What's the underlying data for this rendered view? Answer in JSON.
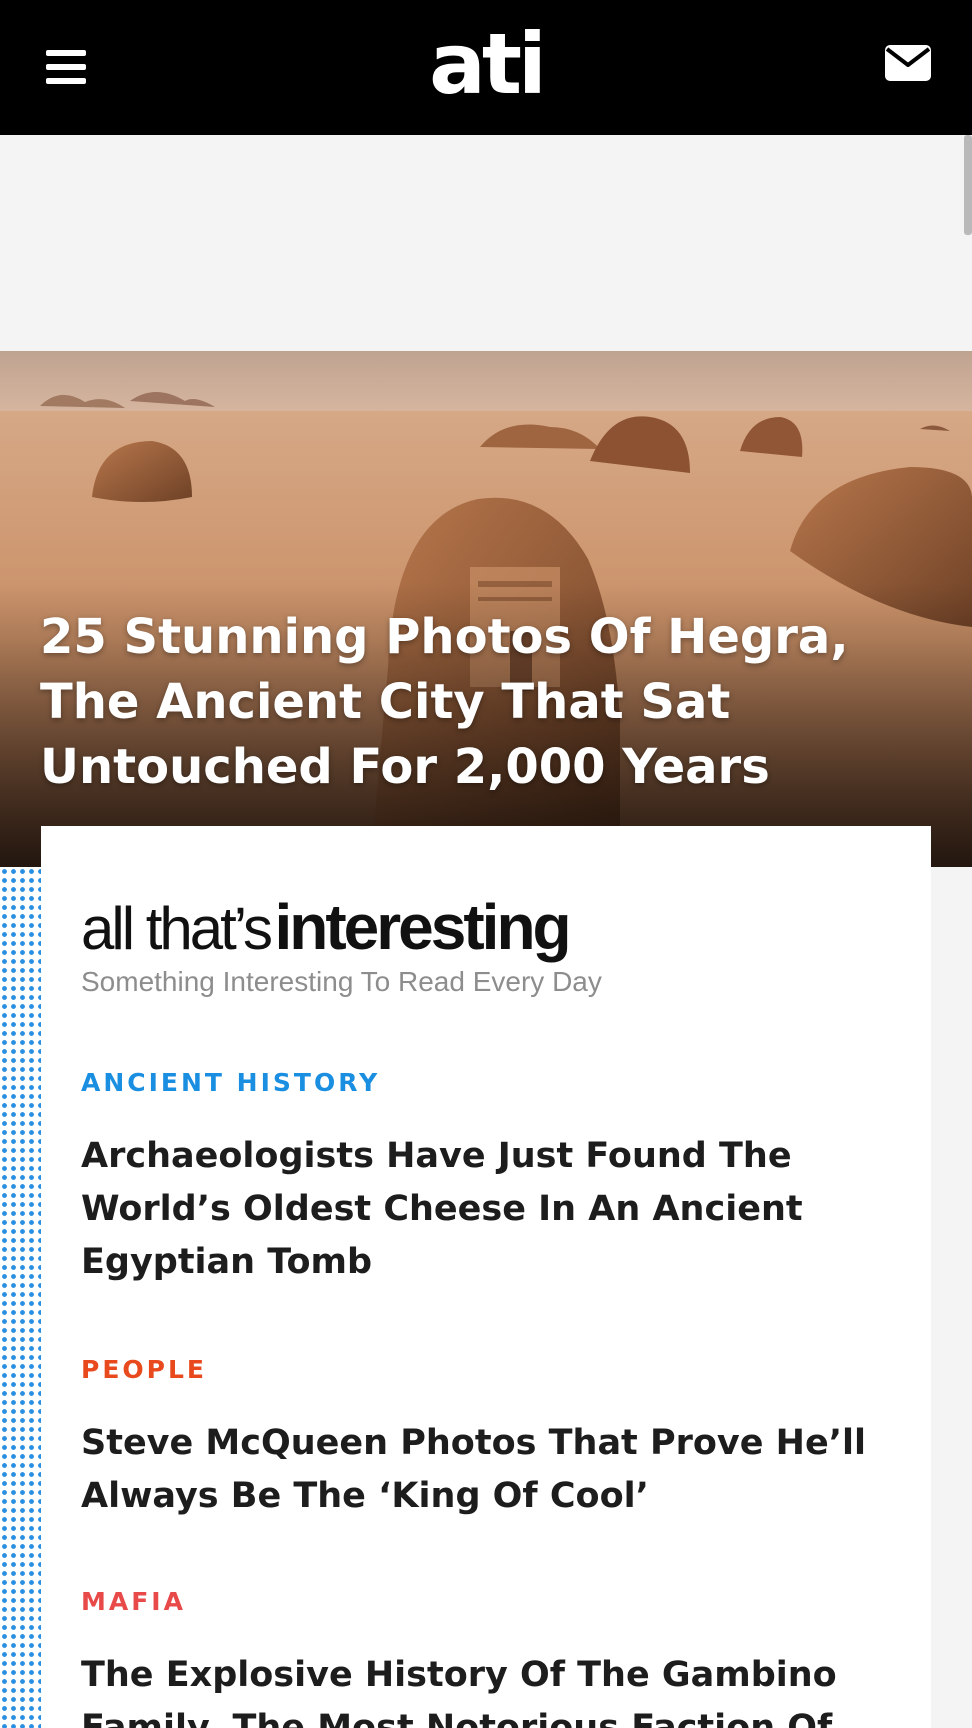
{
  "header": {
    "logo_text": "ati",
    "menu_icon": "hamburger-icon",
    "mail_icon": "envelope-icon"
  },
  "hero": {
    "title": "25 Stunning Photos Of Hegra, The Ancient City That Sat Untouched For 2,000 Years"
  },
  "card": {
    "brand_light": "all that’s",
    "brand_bold": "interesting",
    "tagline": "Something Interesting To Read Every Day",
    "articles": [
      {
        "category": "ANCIENT HISTORY",
        "category_color": "#1a8ee0",
        "title": "Archaeologists Have Just Found The World’s Oldest Cheese In An Ancient Egyptian Tomb"
      },
      {
        "category": "PEOPLE",
        "category_color": "#e8491d",
        "title": "Steve McQueen Photos That Prove He’ll Always Be The ‘King Of Cool’"
      },
      {
        "category": "MAFIA",
        "category_color": "#e84a4a",
        "title": "The Explosive History Of The Gambino Family, The Most Notorious Faction Of"
      }
    ]
  },
  "colors": {
    "header_bg": "#000000",
    "page_bg": "#f4f4f4",
    "dot_blue": "#2a8fe0"
  }
}
